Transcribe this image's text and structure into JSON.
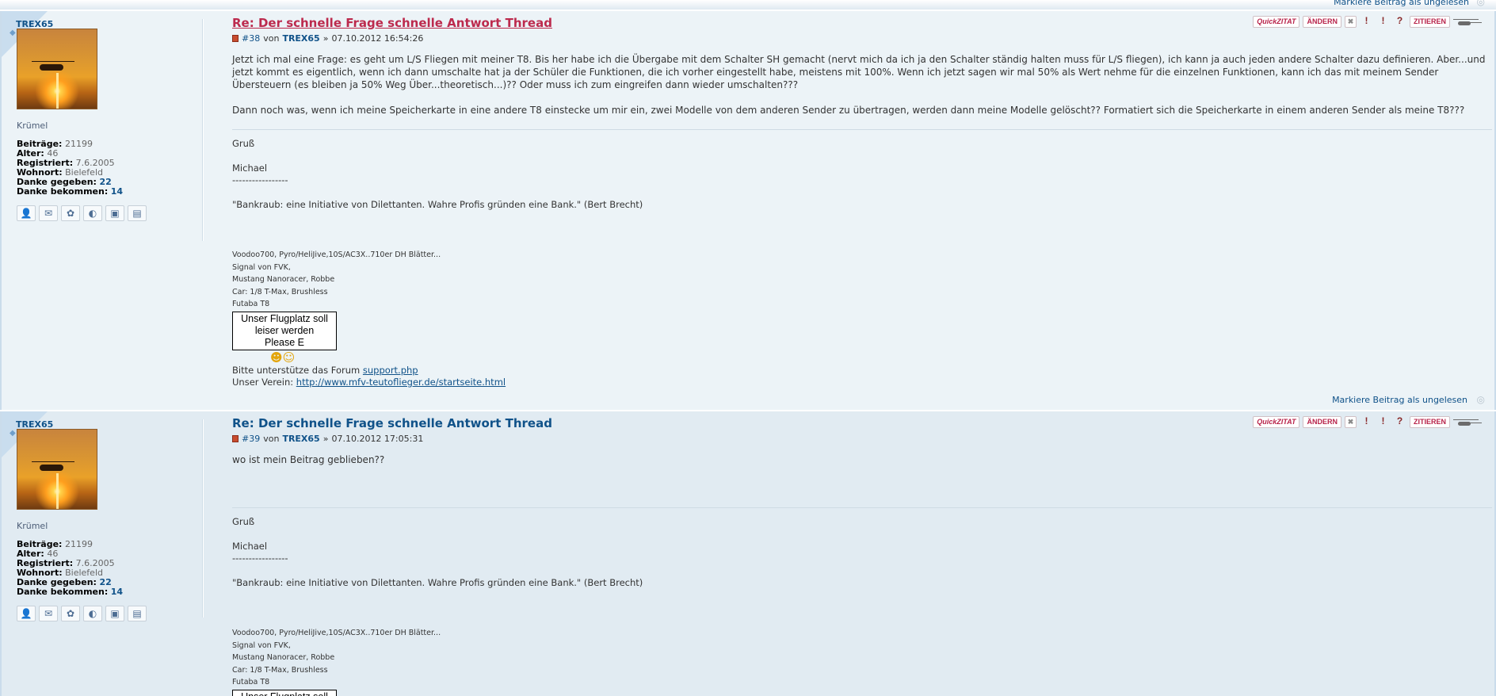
{
  "top": {
    "mark_unread": "Markiere Beitrag als ungelesen"
  },
  "posts": [
    {
      "title": "Re: Der schnelle Frage schnelle Antwort Thread",
      "number": "#38",
      "von": "von",
      "author": "TREX65",
      "sep": "»",
      "date": "07.10.2012 16:54:26",
      "body": [
        "Jetzt ich mal eine Frage: es geht um L/S Fliegen mit meiner T8. Bis her habe ich die Übergabe mit dem Schalter SH gemacht (nervt mich da ich ja den Schalter ständig halten muss für L/S fliegen), ich kann ja auch jeden andere Schalter dazu definieren. Aber...und jetzt kommt es eigentlich, wenn ich dann umschalte hat ja der Schüler die Funktionen, die ich vorher eingestellt habe, meistens mit 100%. Wenn ich jetzt sagen wir mal 50% als Wert nehme für die einzelnen Funktionen, kann ich das mit meinem Sender Übersteuern (es bleiben ja 50% Weg Über...theoretisch...)?? Oder muss ich zum eingreifen dann wieder umschalten???",
        "Dann noch was, wenn ich meine Speicherkarte in eine andere T8 einstecke um mir ein, zwei Modelle von dem anderen Sender zu übertragen, werden dann meine Modelle gelöscht?? Formatiert sich die Speicherkarte in einem anderen Sender als meine T8???"
      ],
      "footer": "Markiere Beitrag als ungelesen"
    },
    {
      "title": "Re: Der schnelle Frage schnelle Antwort Thread",
      "number": "#39",
      "von": "von",
      "author": "TREX65",
      "sep": "»",
      "date": "07.10.2012 17:05:31",
      "body": [
        "wo ist mein Beitrag geblieben??"
      ]
    }
  ],
  "profile": {
    "username": "TREX65",
    "rank": "Krümel",
    "stats": [
      {
        "k": "Beiträge:",
        "v": "21199"
      },
      {
        "k": "Alter:",
        "v": "46"
      },
      {
        "k": "Registriert:",
        "v": "7.6.2005"
      },
      {
        "k": "Wohnort:",
        "v": "Bielefeld"
      },
      {
        "k": "Danke gegeben:",
        "v": "22"
      },
      {
        "k": "Danke bekommen:",
        "v": "14"
      }
    ],
    "contact_icons": [
      "pm-icon",
      "email-icon",
      "icq-icon",
      "website-icon",
      "gallery-icon",
      "film-icon"
    ]
  },
  "signature": {
    "greeting": "Gruß",
    "name": "Michael",
    "dashes": "-----------------",
    "quote": "\"Bankraub: eine Initiative von Dilettanten. Wahre Profis gründen eine Bank.\" (Bert Brecht)",
    "gear": [
      "Voodoo700, Pyro/HeliJive,10S/AC3X..710er DH Blätter...",
      "Signal von FVK,",
      "Mustang Nanoracer, Robbe",
      "Car: 1/8 T-Max, Brushless",
      "Futaba T8"
    ],
    "banner_lines": [
      "Unser Flugplatz soll",
      "leiser werden",
      "Please E"
    ],
    "support_text": "Bitte unterstütze das Forum",
    "support_link": "support.php",
    "verein_text": "Unser Verein:",
    "verein_link": "http://www.mfv-teutoflieger.de/startseite.html"
  },
  "buttons": {
    "quick": "QuickZITAT",
    "edit": "ÄNDERN",
    "delete": "✖",
    "report": "!",
    "warn": "!",
    "info": "?",
    "quote": "ZITIEREN"
  },
  "colors": {
    "link": "#105289",
    "title_hover": "#bc2a4d",
    "post_bg": "#e1ebf2",
    "post_bg_alt": "#ecf3f7"
  }
}
